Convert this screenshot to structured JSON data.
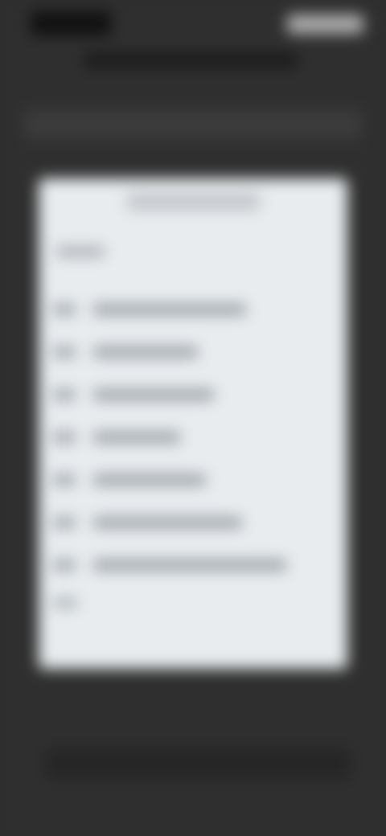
{
  "status_bar": {
    "time": "",
    "icons": [
      "signal-icon",
      "wifi-icon",
      "battery-icon"
    ]
  },
  "header": {
    "title": ""
  },
  "subheader": {
    "text": ""
  },
  "card": {
    "title": "",
    "intro": "",
    "items": [
      {
        "number": "",
        "label": ""
      },
      {
        "number": "",
        "label": ""
      },
      {
        "number": "",
        "label": ""
      },
      {
        "number": "",
        "label": ""
      },
      {
        "number": "",
        "label": ""
      },
      {
        "number": "",
        "label": ""
      },
      {
        "number": "",
        "label": ""
      }
    ],
    "footer": ""
  },
  "bottom_bar": {
    "text": ""
  },
  "colors": {
    "background": "#2f2f2f",
    "card": "#e8ecef",
    "placeholder_dark": "#1a1a1a",
    "placeholder_light": "#9aa0a6"
  }
}
